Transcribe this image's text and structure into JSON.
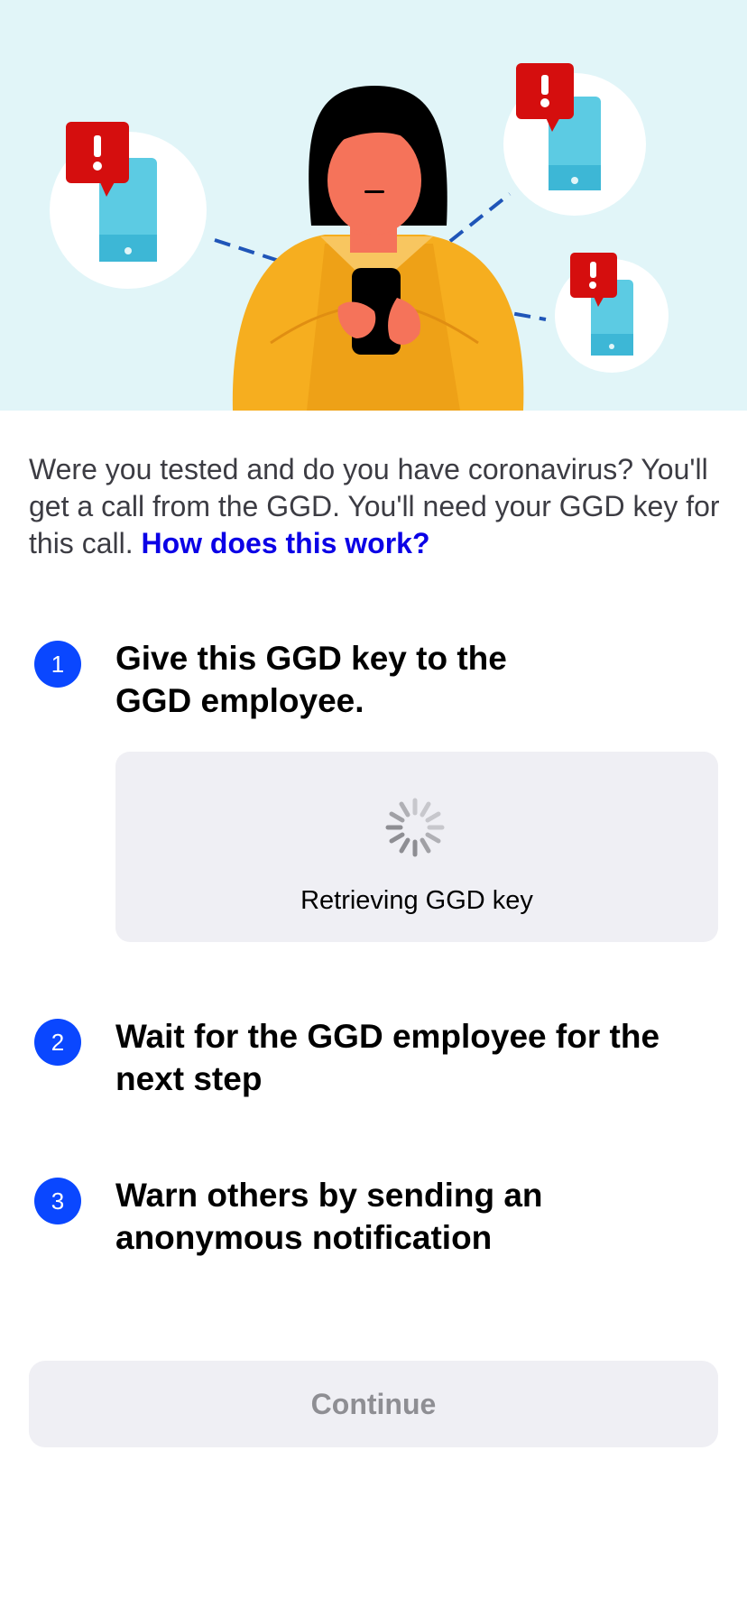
{
  "hero": {
    "illustration": "woman holding phone sending notifications to other phones",
    "colors": {
      "background": "#e1f5f8",
      "sweater": "#f6ae1f",
      "skin": "#f5735a",
      "alert": "#d50e0e",
      "phone": "#5ccbe3"
    }
  },
  "intro": {
    "text": "Were you tested and do you have coronavirus? You'll get a call from the GGD. You'll need your GGD key for this call. ",
    "link": "How does this work?"
  },
  "steps": [
    {
      "number": "1",
      "title": "Give this GGD key to the GGD employee."
    },
    {
      "number": "2",
      "title": "Wait for the GGD employee for the next step"
    },
    {
      "number": "3",
      "title": "Warn others by sending an anonymous notification"
    }
  ],
  "key_box": {
    "status": "Retrieving GGD key",
    "icon": "loading-spinner-icon"
  },
  "continue_label": "Continue",
  "colors": {
    "accent": "#0a47ff",
    "link": "#0b00e6",
    "disabled_text": "#8e8e93",
    "box_bg": "#efeff4"
  }
}
